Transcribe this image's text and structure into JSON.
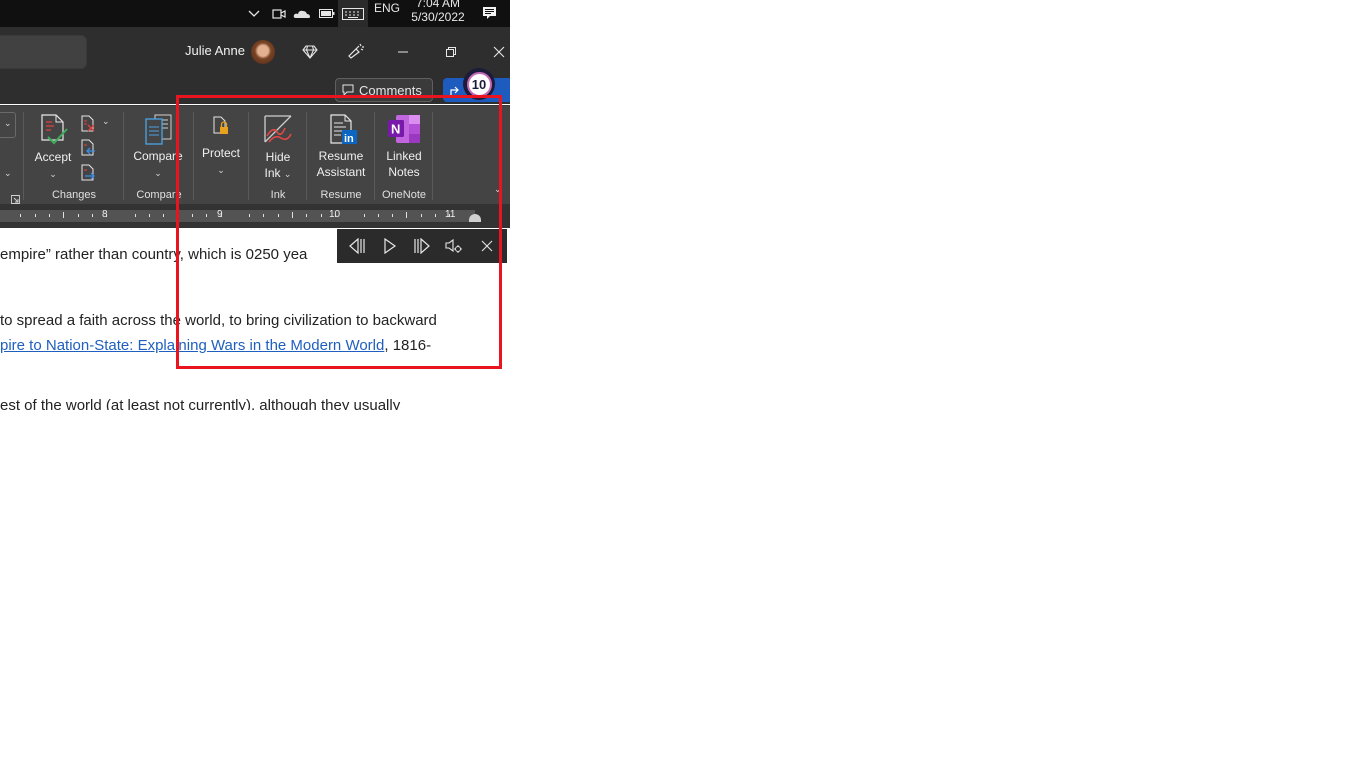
{
  "taskbar": {
    "icons": [
      "chevron-up-icon",
      "meet-now-icon",
      "onedrive-cloud-icon",
      "battery-icon",
      "touch-keyboard-icon",
      "notification-icon"
    ],
    "language": "ENG",
    "time": "7:04 AM",
    "date": "5/30/2022"
  },
  "titlebar": {
    "user_name": "Julie Anne",
    "buttons": [
      "premium-diamond-icon",
      "designer-icon",
      "minimize-icon",
      "restore-icon",
      "close-icon"
    ]
  },
  "ribbon_top": {
    "comments_label": "Comments",
    "share_label": "Share",
    "badge_count": "10"
  },
  "ribbon": {
    "groups": {
      "changes": {
        "label": "Changes",
        "accept_label": "Accept"
      },
      "compare": {
        "label": "Compare",
        "compare_label": "Compare"
      },
      "protect": {
        "protect_label": "Protect"
      },
      "ink": {
        "label": "Ink",
        "hide_ink_line1": "Hide",
        "hide_ink_line2": "Ink"
      },
      "resume": {
        "label": "Resume",
        "line1": "Resume",
        "line2": "Assistant"
      },
      "onenote": {
        "label": "OneNote",
        "line1": "Linked",
        "line2": "Notes"
      }
    }
  },
  "ruler": {
    "numbers": [
      "8",
      "9",
      "10",
      "11"
    ]
  },
  "document": {
    "line1": "empire” rather than country, which is 0250 yea",
    "line2": "to spread a faith across the world, to bring civilization to backward",
    "line3_link": "pire to Nation-State: Explaining Wars in the Modern World",
    "line3_rest": ", 1816-",
    "line4": "est of the world (at least not currently), although they usually"
  },
  "read_aloud": {
    "buttons": [
      "previous-paragraph-icon",
      "play-icon",
      "next-paragraph-icon",
      "voice-settings-icon",
      "close-icon"
    ]
  },
  "colors": {
    "annotation": "#e8141f",
    "link": "#1f5fbf",
    "share": "#1d5bbf"
  }
}
